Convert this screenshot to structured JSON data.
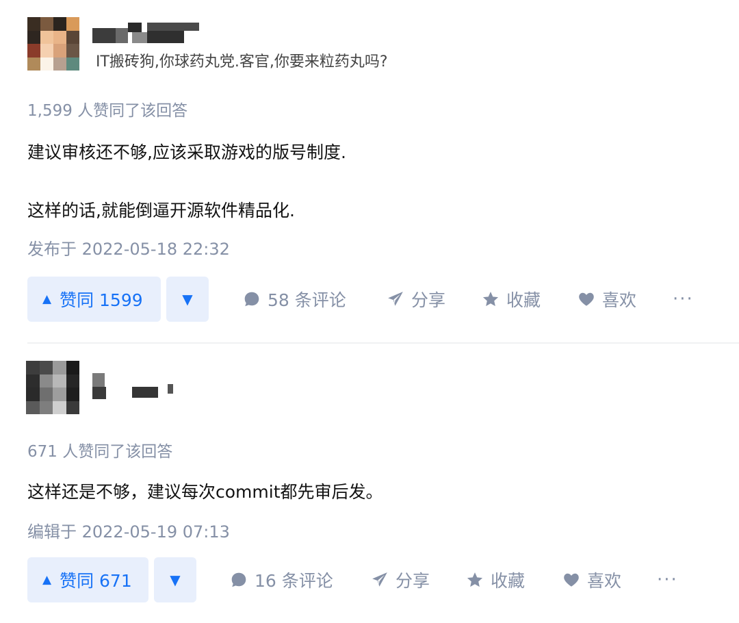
{
  "answers": [
    {
      "bio": "IT搬砖狗,你球药丸党.客官,你要来粒药丸吗?",
      "votes_text": "1,599 人赞同了该回答",
      "content": [
        "建议审核还不够,应该采取游戏的版号制度.",
        "这样的话,就能倒逼开源软件精品化."
      ],
      "time": "发布于 2022-05-18 22:32",
      "upvote_label": "赞同 1599",
      "comments_label": "58 条评论",
      "share_label": "分享",
      "collect_label": "收藏",
      "like_label": "喜欢",
      "more_label": "···"
    },
    {
      "votes_text": "671 人赞同了该回答",
      "content": [
        "这样还是不够，建议每次commit都先审后发。"
      ],
      "time": "编辑于 2022-05-19 07:13",
      "upvote_label": "赞同 671",
      "comments_label": "16 条评论",
      "share_label": "分享",
      "collect_label": "收藏",
      "like_label": "喜欢",
      "more_label": "···"
    }
  ],
  "icons": {
    "upvote": "triangle-up-icon",
    "downvote": "triangle-down-icon",
    "comment": "speech-bubble-icon",
    "share": "paper-plane-icon",
    "collect": "star-icon",
    "like": "heart-icon",
    "more": "ellipsis-icon"
  },
  "colors": {
    "accent": "#1772f6",
    "vote_bg": "#e8effc",
    "meta": "#8590a6",
    "text": "#121212"
  }
}
